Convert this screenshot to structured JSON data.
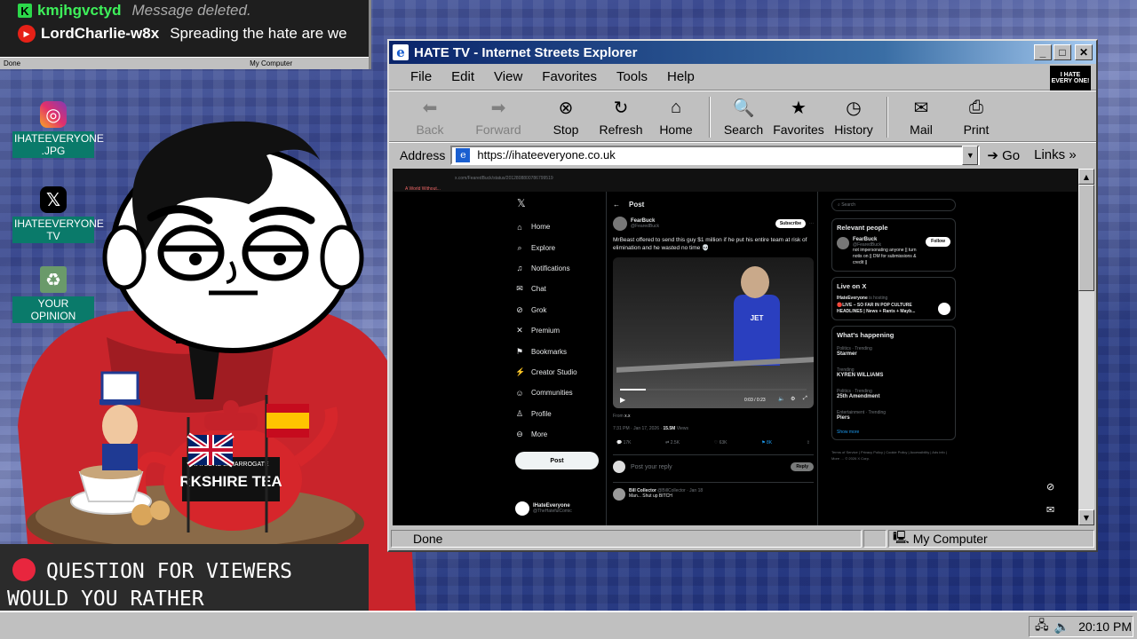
{
  "chat": {
    "messages": [
      {
        "user": "kmjhgvctyd",
        "text": "Message deleted.",
        "badge": "K"
      },
      {
        "user": "LordCharlie-w8x",
        "text": "Spreading the hate are we"
      }
    ],
    "status_done": "Done",
    "status_computer": "My Computer"
  },
  "desktop": {
    "icons": [
      {
        "label": "IHATEEVERYONE .JPG",
        "icon": "instagram-icon"
      },
      {
        "label": "IHATEEVERYONE TV",
        "icon": "x-logo-icon"
      },
      {
        "label": "YOUR OPINION",
        "icon": "recycle-bin-icon"
      }
    ]
  },
  "overlay": {
    "question_line1": "QUESTION FOR VIEWERS",
    "question_line2": "WOULD YOU RATHER"
  },
  "props": {
    "tea_brand": "RKSHIRE TEA",
    "tea_brand_small": "TAYLORS of HARROGATE"
  },
  "browser": {
    "title": "HATE TV - Internet Streets Explorer",
    "menu": [
      "File",
      "Edit",
      "View",
      "Favorites",
      "Tools",
      "Help"
    ],
    "brand_badge": "I HATE EVERY ONE!",
    "toolbar": [
      "Back",
      "Forward",
      "Stop",
      "Refresh",
      "Home",
      "Search",
      "Favorites",
      "History",
      "Mail",
      "Print"
    ],
    "address_label": "Address",
    "url": "https://ihateeveryone.co.uk",
    "go": "Go",
    "links": "Links",
    "status": "Done",
    "zone": "My Computer"
  },
  "xpage": {
    "inner_url": "x.com/FearedBuck/status/2012808800786799519",
    "inner_tab": "A World Without...",
    "nav": [
      "Home",
      "Explore",
      "Notifications",
      "Chat",
      "Grok",
      "Premium",
      "Bookmarks",
      "Creator Studio",
      "Communities",
      "Profile",
      "More"
    ],
    "post_button": "Post",
    "header": "Post",
    "author": "FearBuck",
    "handle": "@FearedBuck",
    "subscribe": "Subscribe",
    "tweet_text": "MrBeast offered to send this guy $1 million if he put his entire team at risk of elimination and he wasted no time 💀",
    "video_time": "0:03 / 0:23",
    "video_jersey": "JET",
    "from_label": "From",
    "from_user": "x.x",
    "meta_time": "7:31 PM · Jan 17, 2026 ·",
    "meta_views": "15.5M",
    "meta_views_label": "Views",
    "stats": [
      "17K",
      "2.5K",
      "63K",
      "8K"
    ],
    "reply_placeholder": "Post your reply",
    "reply_button": "Reply",
    "reply_author": "Bill Collector",
    "reply_handle": "@BillCollector · Jan 18",
    "reply_text": "Man... Shut up BITCH",
    "acct_name": "IHateEveryone",
    "acct_handle": "@TheHatefulComic",
    "search_placeholder": "Search",
    "relevant_title": "Relevant people",
    "rel_name": "FearBuck",
    "rel_handle": "@FearedBuck",
    "rel_follow": "Follow",
    "rel_bio": "not impersonating anyone || turn notis on || DM for submissions & credit ||",
    "live_title": "Live on X",
    "live_host": "IHateEveryone",
    "live_hosting": "is hosting",
    "live_text": "🔴LIVE – SO FAR IN POP CULTURE HEADLINES | News + Rants + Mayb...",
    "happening_title": "What's happening",
    "trends": [
      {
        "cat": "Politics · Trending",
        "name": "Starmer"
      },
      {
        "cat": "Trending",
        "name": "KYREN WILLIAMS"
      },
      {
        "cat": "Politics · Trending",
        "name": "25th Amendment"
      },
      {
        "cat": "Entertainment · Trending",
        "name": "Piers"
      }
    ],
    "show_more": "Show more",
    "footer": "Terms of Service | Privacy Policy | Cookie Policy | Accessibility | Ads info | More … © 2026 X Corp."
  },
  "taskbar": {
    "clock": "20:10 PM"
  },
  "colors": {
    "ie_title": "#0a246a",
    "x_bg": "#000000",
    "teal_label": "#0a7a6a",
    "accent_red": "#e8263e"
  }
}
